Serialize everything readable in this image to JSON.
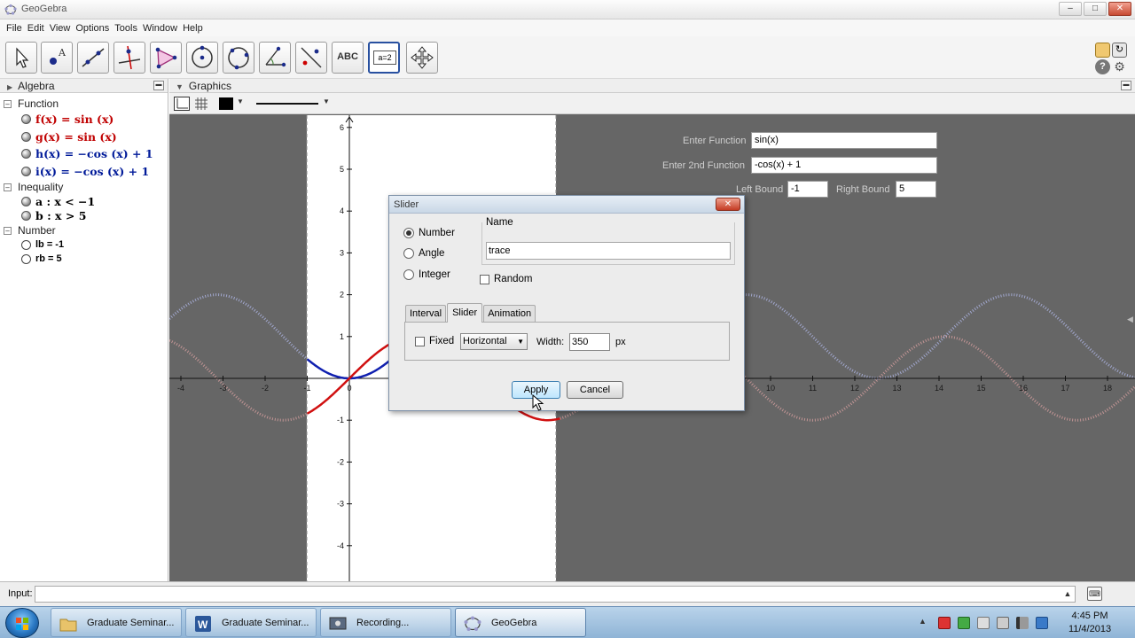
{
  "window": {
    "title": "GeoGebra"
  },
  "menu": [
    "File",
    "Edit",
    "View",
    "Options",
    "Tools",
    "Window",
    "Help"
  ],
  "algebra": {
    "title": "Algebra",
    "categories": [
      {
        "name": "Function",
        "items": [
          {
            "text": "f(x) = sin (x)",
            "color": "#c00000"
          },
          {
            "text": "g(x) = sin (x)",
            "color": "#c00000"
          },
          {
            "text": "h(x) = −cos (x) + 1",
            "color": "#001a99"
          },
          {
            "text": "i(x) = −cos (x) + 1",
            "color": "#001a99"
          }
        ]
      },
      {
        "name": "Inequality",
        "items": [
          {
            "text": "a : x < −1",
            "color": "#000000"
          },
          {
            "text": "b : x > 5",
            "color": "#000000"
          }
        ]
      },
      {
        "name": "Number",
        "items": [
          {
            "text": "lb = -1",
            "color": "#000000"
          },
          {
            "text": "rb = 5",
            "color": "#000000"
          }
        ]
      }
    ]
  },
  "graphics": {
    "title": "Graphics",
    "x_ticks": [
      "-4",
      "-3",
      "-2",
      "-1",
      "0",
      "10",
      "11",
      "12",
      "13",
      "14",
      "15",
      "16",
      "17",
      "18"
    ],
    "y_ticks": [
      "6",
      "5",
      "4",
      "3",
      "2",
      "1",
      "-1",
      "-2",
      "-3",
      "-4"
    ],
    "controls": {
      "fn1_label": "Enter Function",
      "fn1_value": "sin(x)",
      "fn2_label": "Enter 2nd Function",
      "fn2_value": "-cos(x) + 1",
      "left_label": "Left Bound",
      "left_value": "-1",
      "right_label": "Right Bound",
      "right_value": "5"
    }
  },
  "dialog": {
    "title": "Slider",
    "types": [
      "Number",
      "Angle",
      "Integer"
    ],
    "selected_type": "Number",
    "name_label": "Name",
    "name_value": "trace",
    "random_label": "Random",
    "tabs": [
      "Interval",
      "Slider",
      "Animation"
    ],
    "active_tab": "Slider",
    "fixed_label": "Fixed",
    "orientation": "Horizontal",
    "width_label": "Width:",
    "width_value": "350",
    "width_unit": "px",
    "apply_label": "Apply",
    "cancel_label": "Cancel"
  },
  "input_bar": {
    "label": "Input:"
  },
  "taskbar": {
    "items": [
      "Graduate Seminar...",
      "Graduate Seminar...",
      "Recording...",
      "GeoGebra"
    ],
    "time": "4:45 PM",
    "date": "11/4/2013"
  },
  "colors": {
    "red_curve": "#d01010",
    "blue_curve": "#1020b0",
    "plot_bg": "#666666",
    "accent": "#2850a0"
  }
}
